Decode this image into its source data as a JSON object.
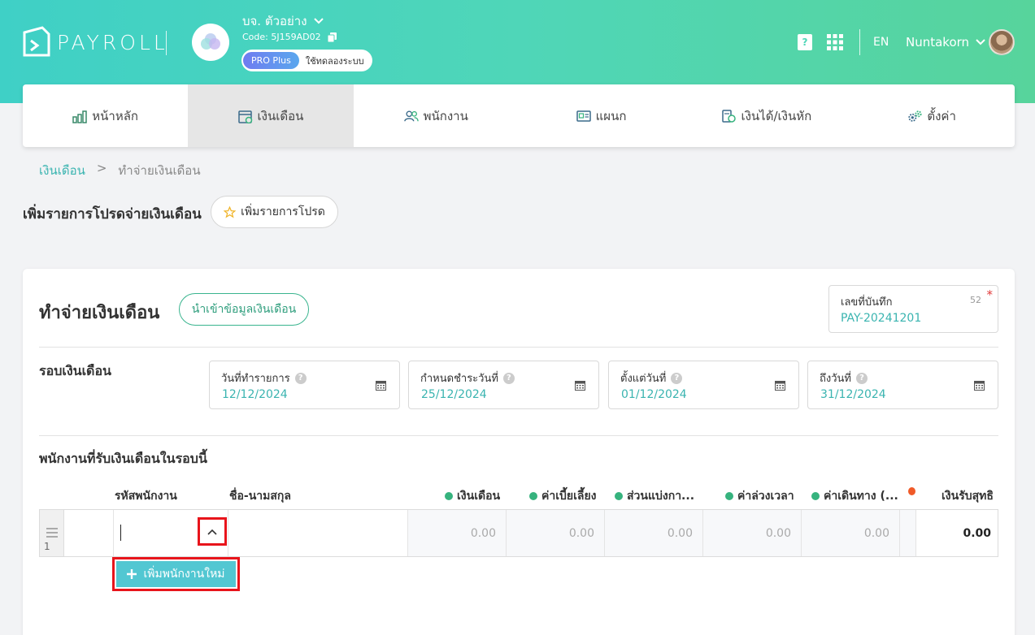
{
  "header": {
    "brand": "PAYROLL",
    "company_name": "บจ. ตัวอย่าง",
    "company_code": "Code: 5J159AD02",
    "plan_badge": "PRO Plus",
    "plan_status": "ใช้ทดลองระบบ",
    "language": "EN",
    "user_name": "Nuntakorn"
  },
  "nav": {
    "items": [
      {
        "label": "หน้าหลัก",
        "icon": "chart-icon"
      },
      {
        "label": "เงินเดือน",
        "icon": "calendar-money-icon",
        "active": true
      },
      {
        "label": "พนักงาน",
        "icon": "users-icon"
      },
      {
        "label": "แผนก",
        "icon": "id-card-icon"
      },
      {
        "label": "เงินได้/เงินหัก",
        "icon": "coins-icon"
      },
      {
        "label": "ตั้งค่า",
        "icon": "gears-icon"
      }
    ]
  },
  "breadcrumb": {
    "parent": "เงินเดือน",
    "separator": ">",
    "current": "ทำจ่ายเงินเดือน"
  },
  "favorite": {
    "title": "เพิ่มรายการโปรดจ่ายเงินเดือน",
    "button": "เพิ่มรายการโปรด"
  },
  "form": {
    "title": "ทำจ่ายเงินเดือน",
    "import_button": "นำเข้าข้อมูลเงินเดือน",
    "record": {
      "label": "เลขที่บันทึก",
      "count": "52",
      "required_mark": "*",
      "value": "PAY-20241201"
    },
    "round_title": "รอบเงินเดือน",
    "dates": [
      {
        "label": "วันที่ทำรายการ",
        "value": "12/12/2024"
      },
      {
        "label": "กำหนดชำระวันที่",
        "value": "25/12/2024"
      },
      {
        "label": "ตั้งแต่วันที่",
        "value": "01/12/2024"
      },
      {
        "label": "ถึงวันที่",
        "value": "31/12/2024"
      }
    ]
  },
  "employees": {
    "title": "พนักงานที่รับเงินเดือนในรอบนี้",
    "columns": {
      "code": "รหัสพนักงาน",
      "name": "ชื่อ-นามสกุล",
      "salary": "เงินเดือน",
      "allowance": "ค่าเบี้ยเลี้ยง",
      "commission": "ส่วนแบ่งกา...",
      "overtime": "ค่าล่วงเวลา",
      "travel": "ค่าเดินทาง (...",
      "net": "เงินรับสุทธิ"
    },
    "row": {
      "number": "1",
      "salary": "0.00",
      "allowance": "0.00",
      "commission": "0.00",
      "overtime": "0.00",
      "travel": "0.00",
      "net": "0.00"
    },
    "add_button": "เพิ่มพนักงานใหม่"
  },
  "colors": {
    "accent": "#3ab4b0",
    "income_dot": "#36b37e",
    "deduction_dot": "#f05a28",
    "highlight": "#e8141b"
  }
}
